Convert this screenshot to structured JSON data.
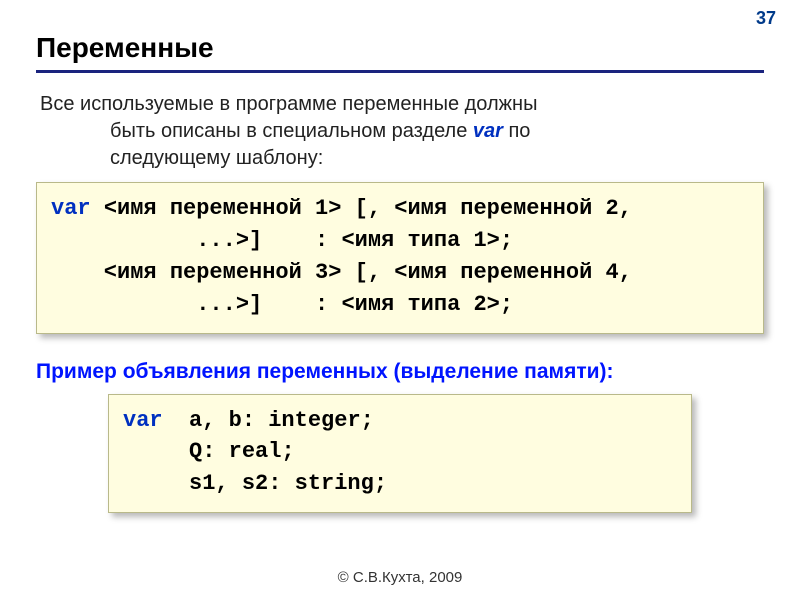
{
  "page_number": "37",
  "title": "Переменные",
  "intro": {
    "line1_prefix": "Все используемые в программе переменные должны",
    "line2_prefix": "быть описаны в специальном разделе ",
    "var_kw": "var",
    "line2_suffix": " по",
    "line3": "следующему шаблону:"
  },
  "template_box": {
    "l1": {
      "kw": "var ",
      "rest": "<имя переменной 1> [, <имя переменной 2,"
    },
    "l2": "           ...>]    : <имя типа 1>;",
    "l3": "    <имя переменной 3> [, <имя переменной 4,",
    "l4": "           ...>]    : <имя типа 2>;"
  },
  "subtitle": "Пример объявления переменных (выделение памяти):",
  "example_box": {
    "l1_kw": "var",
    "l1_rest": "  a, b: integer;",
    "l2": "     Q: real;",
    "l3": "     s1, s2: string;"
  },
  "footer": "© С.В.Кухта, 2009"
}
